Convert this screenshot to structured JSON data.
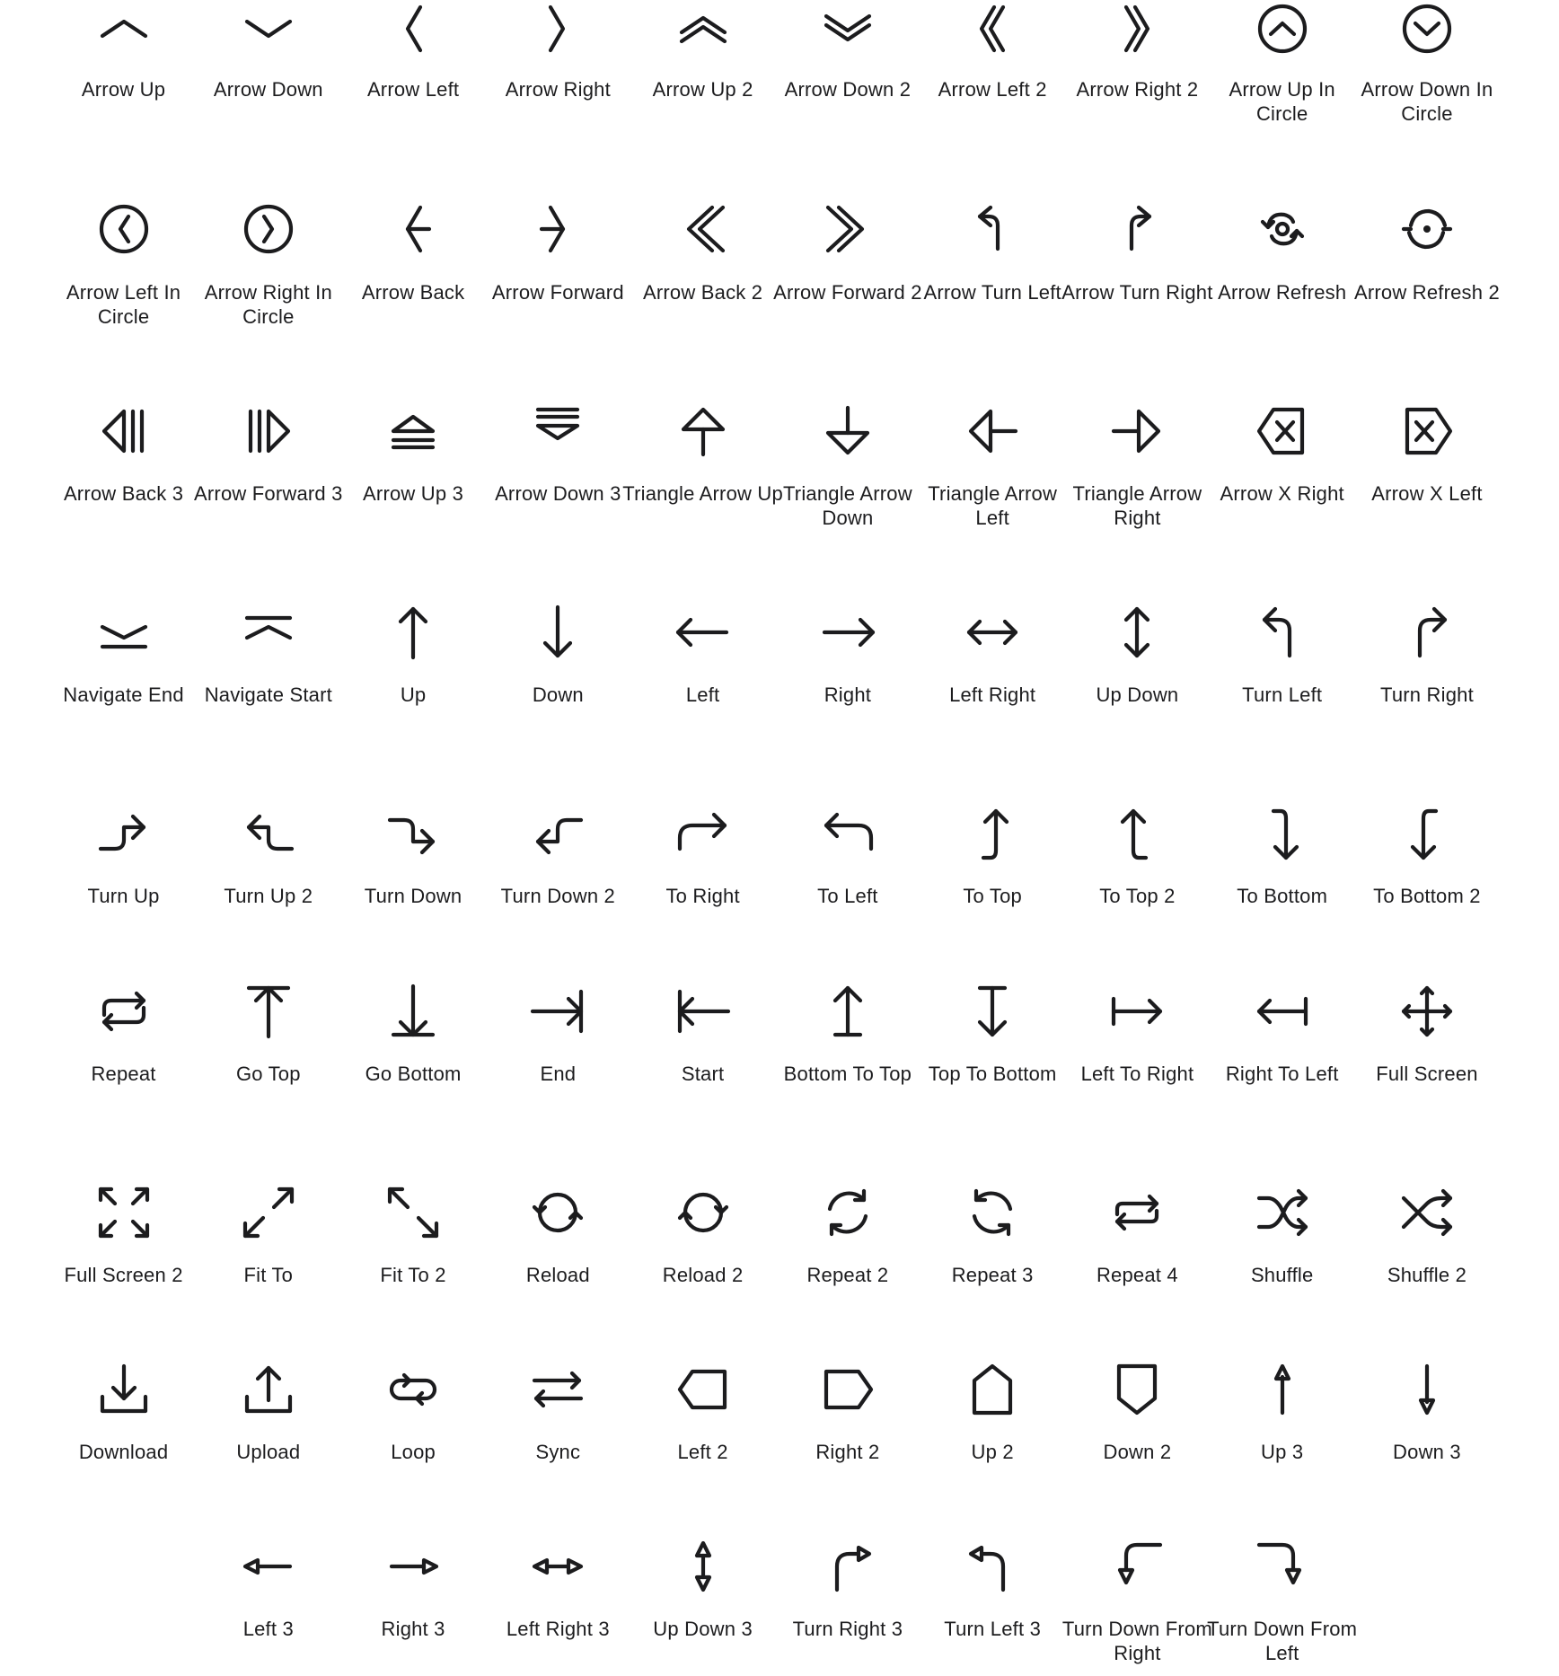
{
  "icons": [
    {
      "name": "Arrow Up",
      "icon": "arrow-up"
    },
    {
      "name": "Arrow Down",
      "icon": "arrow-down"
    },
    {
      "name": "Arrow Left",
      "icon": "arrow-left"
    },
    {
      "name": "Arrow Right",
      "icon": "arrow-right"
    },
    {
      "name": "Arrow Up 2",
      "icon": "arrow-up-2"
    },
    {
      "name": "Arrow Down 2",
      "icon": "arrow-down-2"
    },
    {
      "name": "Arrow Left 2",
      "icon": "arrow-left-2"
    },
    {
      "name": "Arrow Right 2",
      "icon": "arrow-right-2"
    },
    {
      "name": "Arrow Up In Circle",
      "icon": "arrow-up-in-circle"
    },
    {
      "name": "Arrow Down In Circle",
      "icon": "arrow-down-in-circle"
    },
    {
      "name": "Arrow Left In Circle",
      "icon": "arrow-left-in-circle"
    },
    {
      "name": "Arrow Right In Circle",
      "icon": "arrow-right-in-circle"
    },
    {
      "name": "Arrow Back",
      "icon": "arrow-back"
    },
    {
      "name": "Arrow Forward",
      "icon": "arrow-forward"
    },
    {
      "name": "Arrow Back 2",
      "icon": "arrow-back-2"
    },
    {
      "name": "Arrow Forward 2",
      "icon": "arrow-forward-2"
    },
    {
      "name": "Arrow Turn Left",
      "icon": "arrow-turn-left"
    },
    {
      "name": "Arrow Turn Right",
      "icon": "arrow-turn-right"
    },
    {
      "name": "Arrow Refresh",
      "icon": "arrow-refresh"
    },
    {
      "name": "Arrow Refresh 2",
      "icon": "arrow-refresh-2"
    },
    {
      "name": "Arrow Back 3",
      "icon": "arrow-back-3"
    },
    {
      "name": "Arrow Forward 3",
      "icon": "arrow-forward-3"
    },
    {
      "name": "Arrow Up 3",
      "icon": "arrow-up-3"
    },
    {
      "name": "Arrow Down 3",
      "icon": "arrow-down-3"
    },
    {
      "name": "Triangle Arrow Up",
      "icon": "triangle-arrow-up"
    },
    {
      "name": "Triangle Arrow Down",
      "icon": "triangle-arrow-down"
    },
    {
      "name": "Triangle Arrow Left",
      "icon": "triangle-arrow-left"
    },
    {
      "name": "Triangle Arrow Right",
      "icon": "triangle-arrow-right"
    },
    {
      "name": "Arrow X Right",
      "icon": "arrow-x-right"
    },
    {
      "name": "Arrow X Left",
      "icon": "arrow-x-left"
    },
    {
      "name": "Navigate End",
      "icon": "navigate-end"
    },
    {
      "name": "Navigate Start",
      "icon": "navigate-start"
    },
    {
      "name": "Up",
      "icon": "up"
    },
    {
      "name": "Down",
      "icon": "down"
    },
    {
      "name": "Left",
      "icon": "left"
    },
    {
      "name": "Right",
      "icon": "right"
    },
    {
      "name": "Left Right",
      "icon": "left-right"
    },
    {
      "name": "Up Down",
      "icon": "up-down"
    },
    {
      "name": "Turn Left",
      "icon": "turn-left"
    },
    {
      "name": "Turn Right",
      "icon": "turn-right"
    },
    {
      "name": "Turn Up",
      "icon": "turn-up"
    },
    {
      "name": "Turn Up 2",
      "icon": "turn-up-2"
    },
    {
      "name": "Turn Down",
      "icon": "turn-down"
    },
    {
      "name": "Turn Down 2",
      "icon": "turn-down-2"
    },
    {
      "name": "To Right",
      "icon": "to-right"
    },
    {
      "name": "To Left",
      "icon": "to-left"
    },
    {
      "name": "To Top",
      "icon": "to-top"
    },
    {
      "name": "To Top 2",
      "icon": "to-top-2"
    },
    {
      "name": "To Bottom",
      "icon": "to-bottom"
    },
    {
      "name": "To Bottom 2",
      "icon": "to-bottom-2"
    },
    {
      "name": "Repeat",
      "icon": "repeat"
    },
    {
      "name": "Go Top",
      "icon": "go-top"
    },
    {
      "name": "Go Bottom",
      "icon": "go-bottom"
    },
    {
      "name": "End",
      "icon": "end"
    },
    {
      "name": "Start",
      "icon": "start"
    },
    {
      "name": "Bottom To Top",
      "icon": "bottom-to-top"
    },
    {
      "name": "Top To Bottom",
      "icon": "top-to-bottom"
    },
    {
      "name": "Left To Right",
      "icon": "left-to-right"
    },
    {
      "name": "Right To Left",
      "icon": "right-to-left"
    },
    {
      "name": "Full Screen",
      "icon": "full-screen"
    },
    {
      "name": "Full Screen 2",
      "icon": "full-screen-2"
    },
    {
      "name": "Fit To",
      "icon": "fit-to"
    },
    {
      "name": "Fit To 2",
      "icon": "fit-to-2"
    },
    {
      "name": "Reload",
      "icon": "reload"
    },
    {
      "name": "Reload 2",
      "icon": "reload-2"
    },
    {
      "name": "Repeat 2",
      "icon": "repeat-2"
    },
    {
      "name": "Repeat 3",
      "icon": "repeat-3"
    },
    {
      "name": "Repeat 4",
      "icon": "repeat-4"
    },
    {
      "name": "Shuffle",
      "icon": "shuffle"
    },
    {
      "name": "Shuffle 2",
      "icon": "shuffle-2"
    },
    {
      "name": "Download",
      "icon": "download"
    },
    {
      "name": "Upload",
      "icon": "upload"
    },
    {
      "name": "Loop",
      "icon": "loop"
    },
    {
      "name": "Sync",
      "icon": "sync"
    },
    {
      "name": "Left 2",
      "icon": "left-2"
    },
    {
      "name": "Right 2",
      "icon": "right-2"
    },
    {
      "name": "Up 2",
      "icon": "up-2"
    },
    {
      "name": "Down 2",
      "icon": "down-2"
    },
    {
      "name": "Up 3",
      "icon": "up-3"
    },
    {
      "name": "Down 3",
      "icon": "down-3"
    },
    {
      "name": "Left 3",
      "icon": "left-3"
    },
    {
      "name": "Right 3",
      "icon": "right-3"
    },
    {
      "name": "Left Right 3",
      "icon": "left-right-3"
    },
    {
      "name": "Up Down 3",
      "icon": "up-down-3"
    },
    {
      "name": "Turn Right 3",
      "icon": "turn-right-3"
    },
    {
      "name": "Turn Left 3",
      "icon": "turn-left-3"
    },
    {
      "name": "Turn Down From Right",
      "icon": "turn-down-from-right"
    },
    {
      "name": "Turn Down From Left",
      "icon": "turn-down-from-left"
    }
  ]
}
